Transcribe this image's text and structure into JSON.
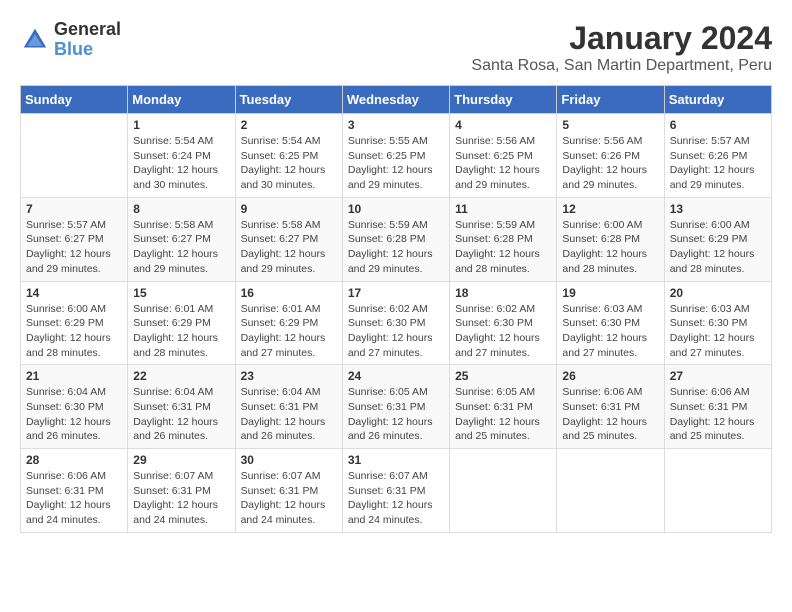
{
  "logo": {
    "general": "General",
    "blue": "Blue"
  },
  "title": "January 2024",
  "subtitle": "Santa Rosa, San Martin Department, Peru",
  "days_of_week": [
    "Sunday",
    "Monday",
    "Tuesday",
    "Wednesday",
    "Thursday",
    "Friday",
    "Saturday"
  ],
  "weeks": [
    [
      {
        "day": "",
        "sunrise": "",
        "sunset": "",
        "daylight": ""
      },
      {
        "day": "1",
        "sunrise": "Sunrise: 5:54 AM",
        "sunset": "Sunset: 6:24 PM",
        "daylight": "Daylight: 12 hours and 30 minutes."
      },
      {
        "day": "2",
        "sunrise": "Sunrise: 5:54 AM",
        "sunset": "Sunset: 6:25 PM",
        "daylight": "Daylight: 12 hours and 30 minutes."
      },
      {
        "day": "3",
        "sunrise": "Sunrise: 5:55 AM",
        "sunset": "Sunset: 6:25 PM",
        "daylight": "Daylight: 12 hours and 29 minutes."
      },
      {
        "day": "4",
        "sunrise": "Sunrise: 5:56 AM",
        "sunset": "Sunset: 6:25 PM",
        "daylight": "Daylight: 12 hours and 29 minutes."
      },
      {
        "day": "5",
        "sunrise": "Sunrise: 5:56 AM",
        "sunset": "Sunset: 6:26 PM",
        "daylight": "Daylight: 12 hours and 29 minutes."
      },
      {
        "day": "6",
        "sunrise": "Sunrise: 5:57 AM",
        "sunset": "Sunset: 6:26 PM",
        "daylight": "Daylight: 12 hours and 29 minutes."
      }
    ],
    [
      {
        "day": "7",
        "sunrise": "Sunrise: 5:57 AM",
        "sunset": "Sunset: 6:27 PM",
        "daylight": "Daylight: 12 hours and 29 minutes."
      },
      {
        "day": "8",
        "sunrise": "Sunrise: 5:58 AM",
        "sunset": "Sunset: 6:27 PM",
        "daylight": "Daylight: 12 hours and 29 minutes."
      },
      {
        "day": "9",
        "sunrise": "Sunrise: 5:58 AM",
        "sunset": "Sunset: 6:27 PM",
        "daylight": "Daylight: 12 hours and 29 minutes."
      },
      {
        "day": "10",
        "sunrise": "Sunrise: 5:59 AM",
        "sunset": "Sunset: 6:28 PM",
        "daylight": "Daylight: 12 hours and 29 minutes."
      },
      {
        "day": "11",
        "sunrise": "Sunrise: 5:59 AM",
        "sunset": "Sunset: 6:28 PM",
        "daylight": "Daylight: 12 hours and 28 minutes."
      },
      {
        "day": "12",
        "sunrise": "Sunrise: 6:00 AM",
        "sunset": "Sunset: 6:28 PM",
        "daylight": "Daylight: 12 hours and 28 minutes."
      },
      {
        "day": "13",
        "sunrise": "Sunrise: 6:00 AM",
        "sunset": "Sunset: 6:29 PM",
        "daylight": "Daylight: 12 hours and 28 minutes."
      }
    ],
    [
      {
        "day": "14",
        "sunrise": "Sunrise: 6:00 AM",
        "sunset": "Sunset: 6:29 PM",
        "daylight": "Daylight: 12 hours and 28 minutes."
      },
      {
        "day": "15",
        "sunrise": "Sunrise: 6:01 AM",
        "sunset": "Sunset: 6:29 PM",
        "daylight": "Daylight: 12 hours and 28 minutes."
      },
      {
        "day": "16",
        "sunrise": "Sunrise: 6:01 AM",
        "sunset": "Sunset: 6:29 PM",
        "daylight": "Daylight: 12 hours and 27 minutes."
      },
      {
        "day": "17",
        "sunrise": "Sunrise: 6:02 AM",
        "sunset": "Sunset: 6:30 PM",
        "daylight": "Daylight: 12 hours and 27 minutes."
      },
      {
        "day": "18",
        "sunrise": "Sunrise: 6:02 AM",
        "sunset": "Sunset: 6:30 PM",
        "daylight": "Daylight: 12 hours and 27 minutes."
      },
      {
        "day": "19",
        "sunrise": "Sunrise: 6:03 AM",
        "sunset": "Sunset: 6:30 PM",
        "daylight": "Daylight: 12 hours and 27 minutes."
      },
      {
        "day": "20",
        "sunrise": "Sunrise: 6:03 AM",
        "sunset": "Sunset: 6:30 PM",
        "daylight": "Daylight: 12 hours and 27 minutes."
      }
    ],
    [
      {
        "day": "21",
        "sunrise": "Sunrise: 6:04 AM",
        "sunset": "Sunset: 6:30 PM",
        "daylight": "Daylight: 12 hours and 26 minutes."
      },
      {
        "day": "22",
        "sunrise": "Sunrise: 6:04 AM",
        "sunset": "Sunset: 6:31 PM",
        "daylight": "Daylight: 12 hours and 26 minutes."
      },
      {
        "day": "23",
        "sunrise": "Sunrise: 6:04 AM",
        "sunset": "Sunset: 6:31 PM",
        "daylight": "Daylight: 12 hours and 26 minutes."
      },
      {
        "day": "24",
        "sunrise": "Sunrise: 6:05 AM",
        "sunset": "Sunset: 6:31 PM",
        "daylight": "Daylight: 12 hours and 26 minutes."
      },
      {
        "day": "25",
        "sunrise": "Sunrise: 6:05 AM",
        "sunset": "Sunset: 6:31 PM",
        "daylight": "Daylight: 12 hours and 25 minutes."
      },
      {
        "day": "26",
        "sunrise": "Sunrise: 6:06 AM",
        "sunset": "Sunset: 6:31 PM",
        "daylight": "Daylight: 12 hours and 25 minutes."
      },
      {
        "day": "27",
        "sunrise": "Sunrise: 6:06 AM",
        "sunset": "Sunset: 6:31 PM",
        "daylight": "Daylight: 12 hours and 25 minutes."
      }
    ],
    [
      {
        "day": "28",
        "sunrise": "Sunrise: 6:06 AM",
        "sunset": "Sunset: 6:31 PM",
        "daylight": "Daylight: 12 hours and 24 minutes."
      },
      {
        "day": "29",
        "sunrise": "Sunrise: 6:07 AM",
        "sunset": "Sunset: 6:31 PM",
        "daylight": "Daylight: 12 hours and 24 minutes."
      },
      {
        "day": "30",
        "sunrise": "Sunrise: 6:07 AM",
        "sunset": "Sunset: 6:31 PM",
        "daylight": "Daylight: 12 hours and 24 minutes."
      },
      {
        "day": "31",
        "sunrise": "Sunrise: 6:07 AM",
        "sunset": "Sunset: 6:31 PM",
        "daylight": "Daylight: 12 hours and 24 minutes."
      },
      {
        "day": "",
        "sunrise": "",
        "sunset": "",
        "daylight": ""
      },
      {
        "day": "",
        "sunrise": "",
        "sunset": "",
        "daylight": ""
      },
      {
        "day": "",
        "sunrise": "",
        "sunset": "",
        "daylight": ""
      }
    ]
  ]
}
